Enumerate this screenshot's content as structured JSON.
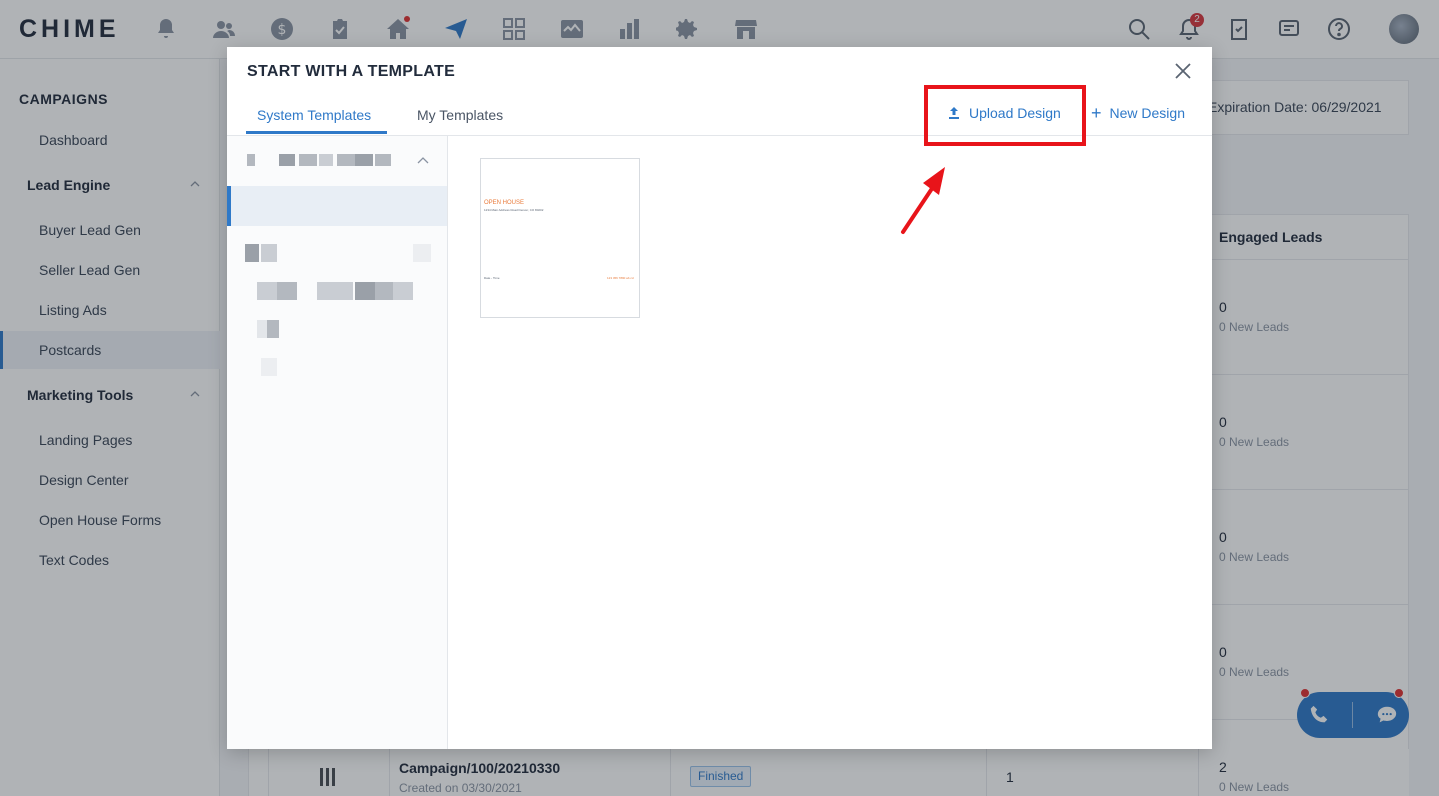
{
  "topbar": {
    "logo": "CHIME",
    "notification_count": "2",
    "icons": [
      "bell-icon",
      "people-icon",
      "dollar-icon",
      "clipboard-icon",
      "home-icon",
      "send-icon",
      "grid-icon",
      "chart-line-icon",
      "bar-chart-icon",
      "gear-icon",
      "store-icon"
    ],
    "right_icons": [
      "search-icon",
      "bell-icon",
      "task-icon",
      "message-icon",
      "help-icon",
      "avatar"
    ]
  },
  "sidebar": {
    "title": "CAMPAIGNS",
    "dashboard": "Dashboard",
    "lead_engine": {
      "label": "Lead Engine",
      "items": [
        "Buyer Lead Gen",
        "Seller Lead Gen",
        "Listing Ads",
        "Postcards"
      ]
    },
    "marketing_tools": {
      "label": "Marketing Tools",
      "items": [
        "Landing Pages",
        "Design Center",
        "Open House Forms",
        "Text Codes"
      ]
    },
    "active_item": "Postcards"
  },
  "background": {
    "expiration": "Expiration Date: 06/29/2021",
    "column_header": "Engaged Leads",
    "rows": [
      {
        "value": "0",
        "sub": "0 New Leads"
      },
      {
        "value": "0",
        "sub": "0 New Leads"
      },
      {
        "value": "0",
        "sub": "0 New Leads"
      },
      {
        "value": "0",
        "sub": "0 New Leads"
      }
    ],
    "last_row": {
      "name": "Campaign/100/20210330",
      "created": "Created on 03/30/2021",
      "status": "Finished",
      "count": "1",
      "engaged": "2",
      "engaged_sub": "0 New Leads"
    }
  },
  "modal": {
    "title": "START WITH A TEMPLATE",
    "tabs": [
      "System Templates",
      "My Templates"
    ],
    "active_tab": "System Templates",
    "upload_label": "Upload Design",
    "new_label": "New Design",
    "thumbnail": {
      "title": "OPEN HOUSE",
      "address_line": "1234 Main Address Road Denver, CO 80202",
      "footer_left": "Date - Time",
      "footer_right": "123 456 7890 ab cd"
    }
  },
  "colors": {
    "accent": "#2f79c8",
    "annotation": "#e8141a",
    "badge": "#d9363e",
    "status_finished_bg": "#e8f2fc"
  }
}
